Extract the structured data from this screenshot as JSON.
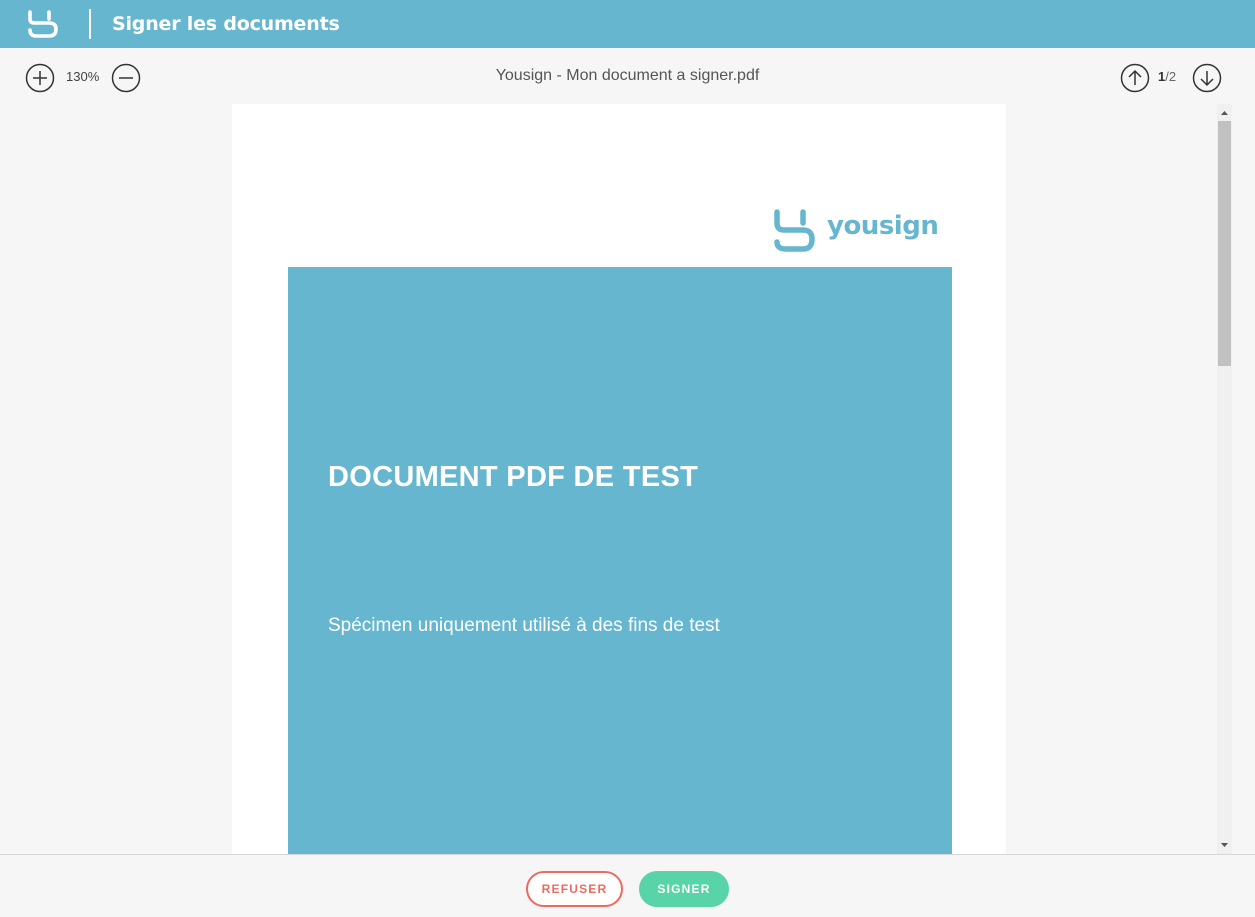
{
  "header": {
    "title": "Signer les documents",
    "logo_icon": "yousign-mark-icon"
  },
  "toolbar": {
    "zoom_level": "130%",
    "document_name": "Yousign - Mon document a signer.pdf",
    "page_current": "1",
    "page_separator": "/",
    "page_total": "2"
  },
  "document": {
    "logo_text": "yousign",
    "title": "DOCUMENT PDF DE TEST",
    "subtitle": "Spécimen uniquement utilisé à des fins de test"
  },
  "actions": {
    "refuse_label": "REFUSER",
    "sign_label": "SIGNER"
  },
  "colors": {
    "brand": "#67b6d0",
    "refuse": "#ef6a5e",
    "sign": "#59d4a9"
  }
}
